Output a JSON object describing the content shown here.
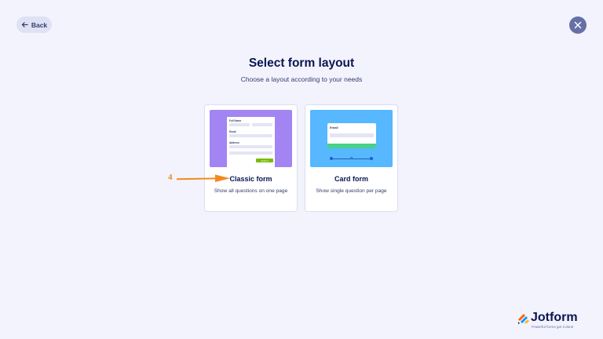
{
  "header": {
    "back_label": "Back",
    "back_icon": "arrow-left-icon",
    "close_icon": "close-icon"
  },
  "main": {
    "title": "Select form layout",
    "subtitle": "Choose a layout according to your needs"
  },
  "layouts": [
    {
      "label": "Classic form",
      "description": "Show all questions on one page",
      "preview_color": "#a284f3",
      "preview": {
        "field_labels": [
          "Full Name",
          "Email",
          "Address"
        ],
        "submit_label": "Submit"
      }
    },
    {
      "label": "Card form",
      "description": "Show single question per page",
      "preview_color": "#57b7ff",
      "preview": {
        "field_label": "Email"
      }
    }
  ],
  "annotation": {
    "step_number": "4",
    "color": "#f28a1e"
  },
  "logo": {
    "name": "Jotform",
    "tagline": "Powerful forms get it done"
  },
  "colors": {
    "background": "#f3f3fe",
    "navy": "#0a1551",
    "close_button": "#6770a6",
    "back_button": "#dfe1f4"
  }
}
